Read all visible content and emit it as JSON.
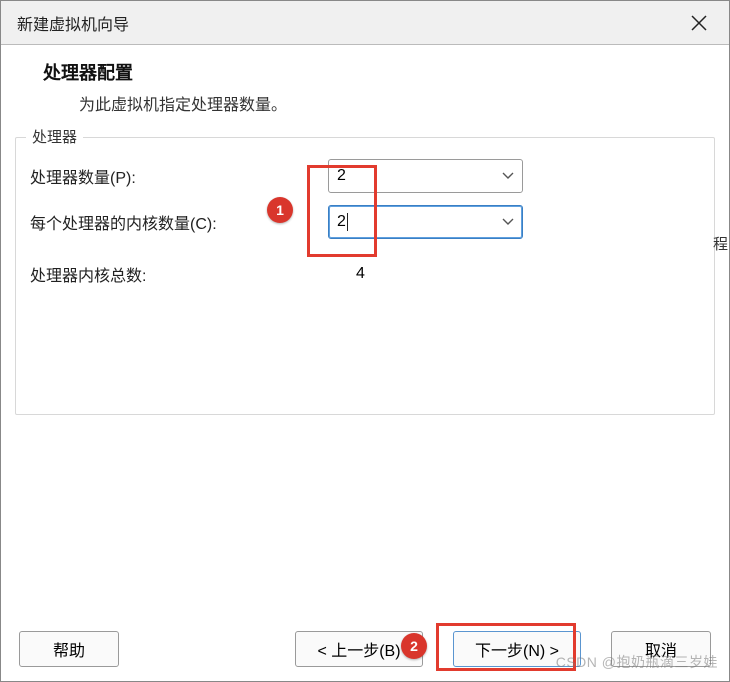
{
  "title": "新建虚拟机向导",
  "header": {
    "title": "处理器配置",
    "desc": "为此虚拟机指定处理器数量。"
  },
  "group": {
    "label": "处理器"
  },
  "rows": {
    "count": {
      "label": "处理器数量(P):",
      "value": "2"
    },
    "cores": {
      "label": "每个处理器的内核数量(C):",
      "value": "2"
    },
    "total": {
      "label": "处理器内核总数:",
      "value": "4"
    }
  },
  "buttons": {
    "help": "帮助",
    "back": "< 上一步(B)",
    "next": "下一步(N) >",
    "cancel": "取消"
  },
  "annotations": {
    "badge1": "1",
    "badge2": "2"
  },
  "watermark": "CSDN @抱奶瓶滴三岁娃",
  "side_char": "程"
}
